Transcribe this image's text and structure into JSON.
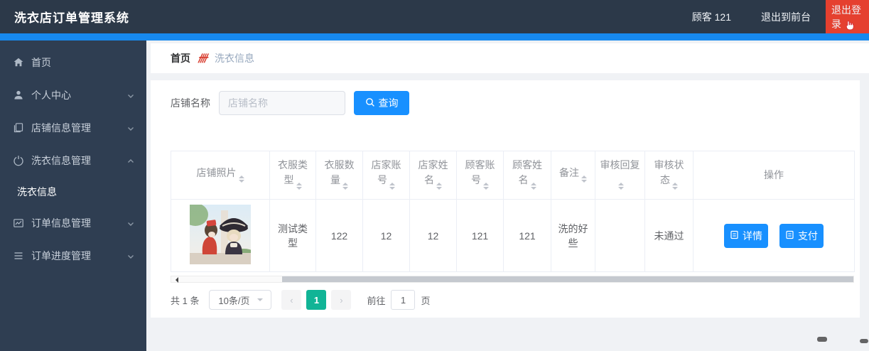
{
  "app": {
    "title": "洗衣店订单管理系统"
  },
  "header": {
    "nav": {
      "customer": "顾客 121",
      "exit_front": "退出到前台",
      "logout": "退出登录"
    }
  },
  "sidebar": {
    "items": [
      {
        "label": "首页",
        "icon": "home-icon",
        "expandable": false
      },
      {
        "label": "个人中心",
        "icon": "user-icon",
        "expandable": true,
        "expanded": false
      },
      {
        "label": "店铺信息管理",
        "icon": "copy-document-icon",
        "expandable": true,
        "expanded": false
      },
      {
        "label": "洗衣信息管理",
        "icon": "power-icon",
        "expandable": true,
        "expanded": true,
        "children": [
          {
            "label": "洗衣信息"
          }
        ]
      },
      {
        "label": "订单信息管理",
        "icon": "trend-chart-icon",
        "expandable": true,
        "expanded": false
      },
      {
        "label": "订单进度管理",
        "icon": "operation-list-icon",
        "expandable": true,
        "expanded": false
      }
    ]
  },
  "breadcrumb": {
    "home": "首页",
    "separator": "卌",
    "current": "洗衣信息"
  },
  "search": {
    "label": "店铺名称",
    "placeholder": "店铺名称",
    "value": "",
    "button_label": "查询"
  },
  "table": {
    "columns": [
      {
        "label": "店铺照片",
        "sortable": true
      },
      {
        "label": "衣服类型",
        "sortable": true
      },
      {
        "label": "衣服数量",
        "sortable": true
      },
      {
        "label": "店家账号",
        "sortable": true
      },
      {
        "label": "店家姓名",
        "sortable": true
      },
      {
        "label": "顾客账号",
        "sortable": true
      },
      {
        "label": "顾客姓名",
        "sortable": true
      },
      {
        "label": "备注",
        "sortable": true
      },
      {
        "label": "审核回复",
        "sortable": true
      },
      {
        "label": "审核状态",
        "sortable": true
      },
      {
        "label": "操作",
        "sortable": false
      }
    ],
    "row": {
      "photo": "店铺照片（动漫人物插画）",
      "clothes_type": "测试类型",
      "clothes_count": "122",
      "shop_account": "12",
      "shop_name": "12",
      "customer_account": "121",
      "customer_name": "121",
      "remark": "洗的好些",
      "audit_reply": "",
      "audit_status": "未通过"
    },
    "actions": {
      "detail": "详情",
      "pay": "支付"
    }
  },
  "pagination": {
    "total_text": "共 1 条",
    "page_size": "10条/页",
    "prev": "‹",
    "current_page": "1",
    "next": "›",
    "goto_label": "前往",
    "goto_value": "1",
    "page_unit": "页"
  },
  "colors": {
    "topbar_bg": "#2c3949",
    "sidebar_bg": "#2f3e52",
    "accent_blue": "#1890ff",
    "strip_blue": "#1789ee",
    "logout_red": "#e5402f",
    "active_page_green": "#11b496",
    "page_bg": "#f0f2f5",
    "table_border": "#ebeef5"
  }
}
